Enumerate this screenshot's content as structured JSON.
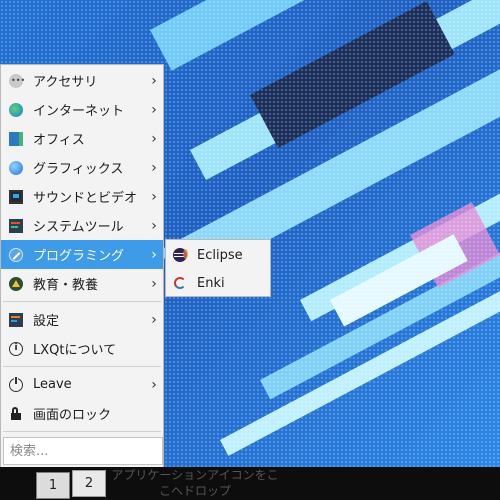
{
  "menu": {
    "items": [
      {
        "label": "アクセサリ",
        "icon": "accessories-icon"
      },
      {
        "label": "インターネット",
        "icon": "internet-globe-icon"
      },
      {
        "label": "オフィス",
        "icon": "office-icon"
      },
      {
        "label": "グラフィックス",
        "icon": "graphics-icon"
      },
      {
        "label": "サウンドとビデオ",
        "icon": "sound-video-icon"
      },
      {
        "label": "システムツール",
        "icon": "system-tools-icon"
      },
      {
        "label": "プログラミング",
        "icon": "programming-icon"
      },
      {
        "label": "教育・教養",
        "icon": "education-icon"
      },
      {
        "label": "設定",
        "icon": "settings-icon"
      },
      {
        "label": "LXQtについて",
        "icon": "info-icon"
      },
      {
        "label": "Leave",
        "icon": "power-icon"
      },
      {
        "label": "画面のロック",
        "icon": "lock-icon"
      }
    ],
    "search_placeholder": "検索..."
  },
  "submenu": {
    "items": [
      {
        "label": "Eclipse",
        "icon": "eclipse-icon"
      },
      {
        "label": "Enki",
        "icon": "enki-icon"
      }
    ]
  },
  "taskbar": {
    "desktops": [
      "1",
      "2"
    ],
    "quicklaunch_hint": "アプリケーションアイコンをここへドロップ"
  },
  "colors": {
    "menu_bg": "#f3f3f3",
    "highlight": "#3e9be8",
    "taskbar_bg": "#0d0d0d",
    "wallpaper": "#1f6fd3"
  }
}
